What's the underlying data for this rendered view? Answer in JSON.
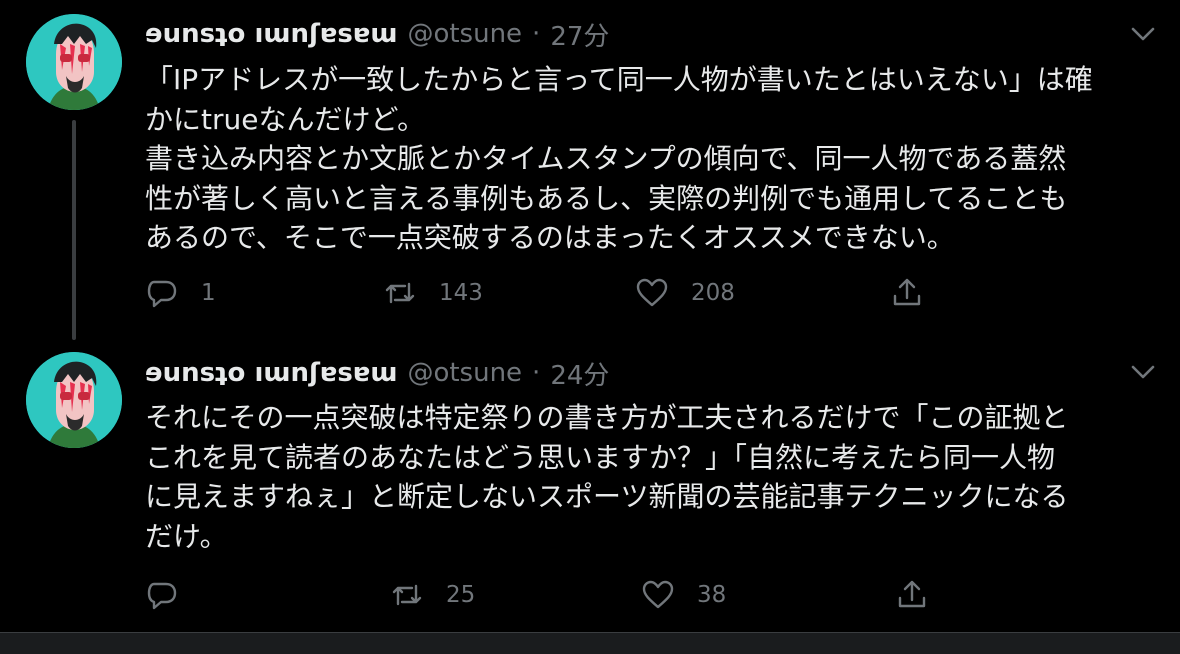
{
  "tweets": [
    {
      "author_name": "ɘunsʇo ıɯnʃɐsɐɯ",
      "handle": "@otsune",
      "separator": "·",
      "time": "27分",
      "text": "「IPアドレスが一致したからと言って同一人物が書いたとはいえない」は確\nかにtrueなんだけど。\n書き込み内容とか文脈とかタイムスタンプの傾向で、同一人物である蓋然\n性が著しく高いと言える事例もあるし、実際の判例でも通用してることも\nあるので、そこで一点突破するのはまったくオススメできない。",
      "reply_count": "1",
      "retweet_count": "143",
      "like_count": "208"
    },
    {
      "author_name": "ɘunsʇo ıɯnʃɐsɐɯ",
      "handle": "@otsune",
      "separator": "·",
      "time": "24分",
      "text": "それにその一点突破は特定祭りの書き方が工夫されるだけで「この証拠と\nこれを見て読者のあなたはどう思いますか？」「自然に考えたら同一人物\nに見えますねぇ」と断定しないスポーツ新聞の芸能記事テクニックになる\nだけ。",
      "reply_count": "",
      "retweet_count": "25",
      "like_count": "38"
    }
  ],
  "colors": {
    "background": "#000000",
    "text": "#e7e9ea",
    "muted": "#71767b",
    "avatar_bg": "#2ec7c0",
    "thread_line": "#3a3d40"
  },
  "icons": {
    "reply": "reply-icon",
    "retweet": "retweet-icon",
    "like": "heart-icon",
    "share": "share-icon",
    "more": "chevron-down-icon"
  }
}
